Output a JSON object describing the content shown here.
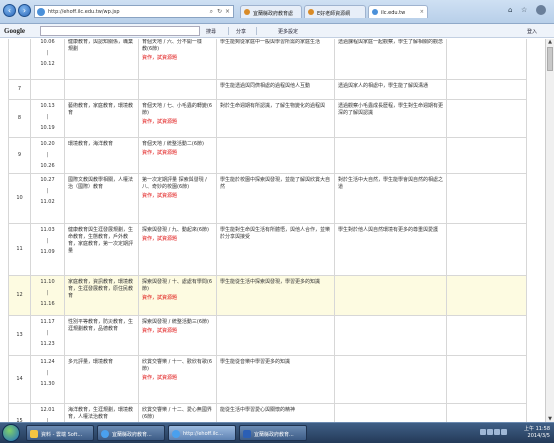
{
  "browser": {
    "url": "http://ehoff.ilc.edu.tw/wp.jsp",
    "tabs": [
      {
        "label": "宜蘭縣政府教育處"
      },
      {
        "label": "E好老師資源網"
      },
      {
        "label": "ilc.edu.tw"
      }
    ],
    "toolbar": {
      "google": "Google",
      "search_btn": "搜尋",
      "share": "分享",
      "more": "更多設定",
      "login": "登入"
    }
  },
  "schedule": {
    "rows": [
      {
        "no": "",
        "date_from": "10.06",
        "date_to": "10.12",
        "topic": "健康教育，與認知關係，職業規劃",
        "unit": "育個天地 / 六、分不開一樣",
        "unit2": "教(6節)",
        "tag": "資作，試資源題",
        "goal": "學生能夠從家庭中一般與學習所需的家庭生活",
        "extra": "透過課程與家庭一起觀察，學生了解相關的觀念",
        "note": ""
      },
      {
        "no": "7",
        "date_from": "",
        "date_to": "",
        "topic": "",
        "unit": "",
        "unit2": "",
        "tag": "",
        "goal": "學生能透過與同儕相處的過程與他人互動",
        "extra": "透過與家人的相處中，學生能了解與溝通",
        "note": ""
      },
      {
        "no": "8",
        "date_from": "10.13",
        "date_to": "10.19",
        "topic": "藝術教育，家庭教育，環境教育",
        "unit": "育個天地 / 七、小毛蟲的轉變(6節)",
        "unit2": "",
        "tag": "資作，試資源題",
        "goal": "對於生命週期有所認識，了解生物變化的過程與",
        "extra": "透過觀察小毛蟲成長歷程，學生對生命週期有更深的了解與認識",
        "note": ""
      },
      {
        "no": "9",
        "date_from": "10.20",
        "date_to": "10.26",
        "topic": "環境教育，海洋教育",
        "unit": "育個天地 / 統整活動二(6節)",
        "unit2": "",
        "tag": "資作，試資源題",
        "goal": "",
        "extra": "",
        "note": ""
      },
      {
        "no": "10",
        "date_from": "10.27",
        "date_to": "11.02",
        "topic": "國際文教與教學相關，人權法治（國際）教育",
        "unit": "第一次定期評量 探索與發現 / 八、奇妙的校園(6節)",
        "unit2": "",
        "tag": "資作，試資源題",
        "goal": "學生能於校園中探索與發現，並能了解與欣賞大自然",
        "extra": "對於生活中大自然，學生能學會與自然的相處之道",
        "note": ""
      },
      {
        "no": "11",
        "date_from": "11.03",
        "date_to": "11.09",
        "topic": "健康教育與生涯發展規劃，生命教育，生態教育，戶外教育，家庭教育，第一次定期評量",
        "unit": "探索與發現 / 九、動起來(6節)",
        "unit2": "",
        "tag": "資作，試資源題",
        "goal": "學生能對生命與生活有所體悟，與他人合作，並樂於分享與接受",
        "extra": "學生對於他人與自然環境有更多的尊重與愛護",
        "note": ""
      },
      {
        "no": "12",
        "date_from": "11.10",
        "date_to": "11.16",
        "topic": "家庭教育，資訊教育，環境教育，生涯發展教育，原住民教育",
        "unit": "探索與發現 / 十、處處有學問(6節)",
        "unit2": "",
        "tag": "資作，試資源題",
        "goal": "學生能從生活中探索與發現，學習更多的知識",
        "extra": "",
        "note": ""
      },
      {
        "no": "13",
        "date_from": "11.17",
        "date_to": "11.23",
        "topic": "性別平等教育，防災教育，生涯規劃教育，品德教育",
        "unit": "探索與發現 / 統整活動三(6節)",
        "unit2": "",
        "tag": "資作，試資源題",
        "goal": "",
        "extra": "",
        "note": ""
      },
      {
        "no": "14",
        "date_from": "11.24",
        "date_to": "11.30",
        "topic": "多元評量，環境教育",
        "unit": "欣賞交響樂 / 十一、歡欣有歌(6節)",
        "unit2": "",
        "tag": "資作，試資源題",
        "goal": "學生能從音樂中學習更多的知識",
        "extra": "",
        "note": ""
      },
      {
        "no": "15",
        "date_from": "12.01",
        "date_to": "12.07",
        "topic": "海洋教育，生涯規劃，環境教育，人權法治教育",
        "unit": "欣賞交響樂 / 十二、愛心無國界(6節)",
        "unit2": "",
        "tag": "",
        "goal": "能從生活中學習愛心與關懷的精神",
        "extra": "",
        "note": ""
      }
    ]
  },
  "taskbar": {
    "tasks": [
      {
        "label": "資料 - 雲端 Soft..."
      },
      {
        "label": "宜蘭縣政府教育..."
      },
      {
        "label": "http://ehoff.ilc..."
      },
      {
        "label": "宜蘭縣政府教育..."
      }
    ],
    "time": "上午 11:58",
    "date": "2014/3/5"
  }
}
